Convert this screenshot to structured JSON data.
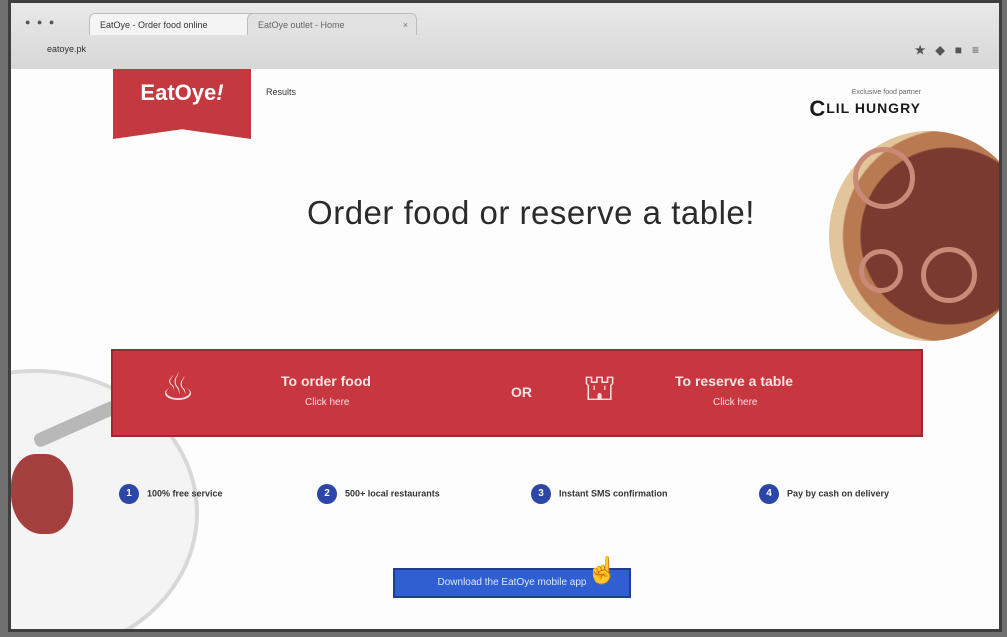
{
  "browser": {
    "window_controls": "● ● ●",
    "tabs": [
      {
        "label": "EatOye - Order food online",
        "close": "×"
      },
      {
        "label": "EatOye outlet - Home",
        "close": "×"
      }
    ],
    "address": "eatoye.pk",
    "toolbar_icons": [
      "star-icon",
      "shield-icon",
      "extension-icon",
      "menu-icon"
    ]
  },
  "header": {
    "logo": "EatOye",
    "logo_suffix": "!",
    "nav_link": "Results",
    "partner_small": "Exclusive food partner",
    "partner_name": "LIL HUNGRY"
  },
  "hero": {
    "headline": "Order food or reserve a table!"
  },
  "actions": {
    "order_title": "To order food",
    "order_sub": "Click here",
    "or_label": "OR",
    "reserve_title": "To reserve a table",
    "reserve_sub": "Click here"
  },
  "features": [
    {
      "num": "1",
      "label": "100% free service"
    },
    {
      "num": "2",
      "label": "500+ local restaurants"
    },
    {
      "num": "3",
      "label": "Instant SMS confirmation"
    },
    {
      "num": "4",
      "label": "Pay by cash on delivery"
    }
  ],
  "cta": {
    "label": "Download the EatOye mobile app"
  },
  "colors": {
    "brand_red": "#c8363f",
    "feature_blue": "#2d47a8",
    "cta_blue": "#2f5fd0"
  }
}
